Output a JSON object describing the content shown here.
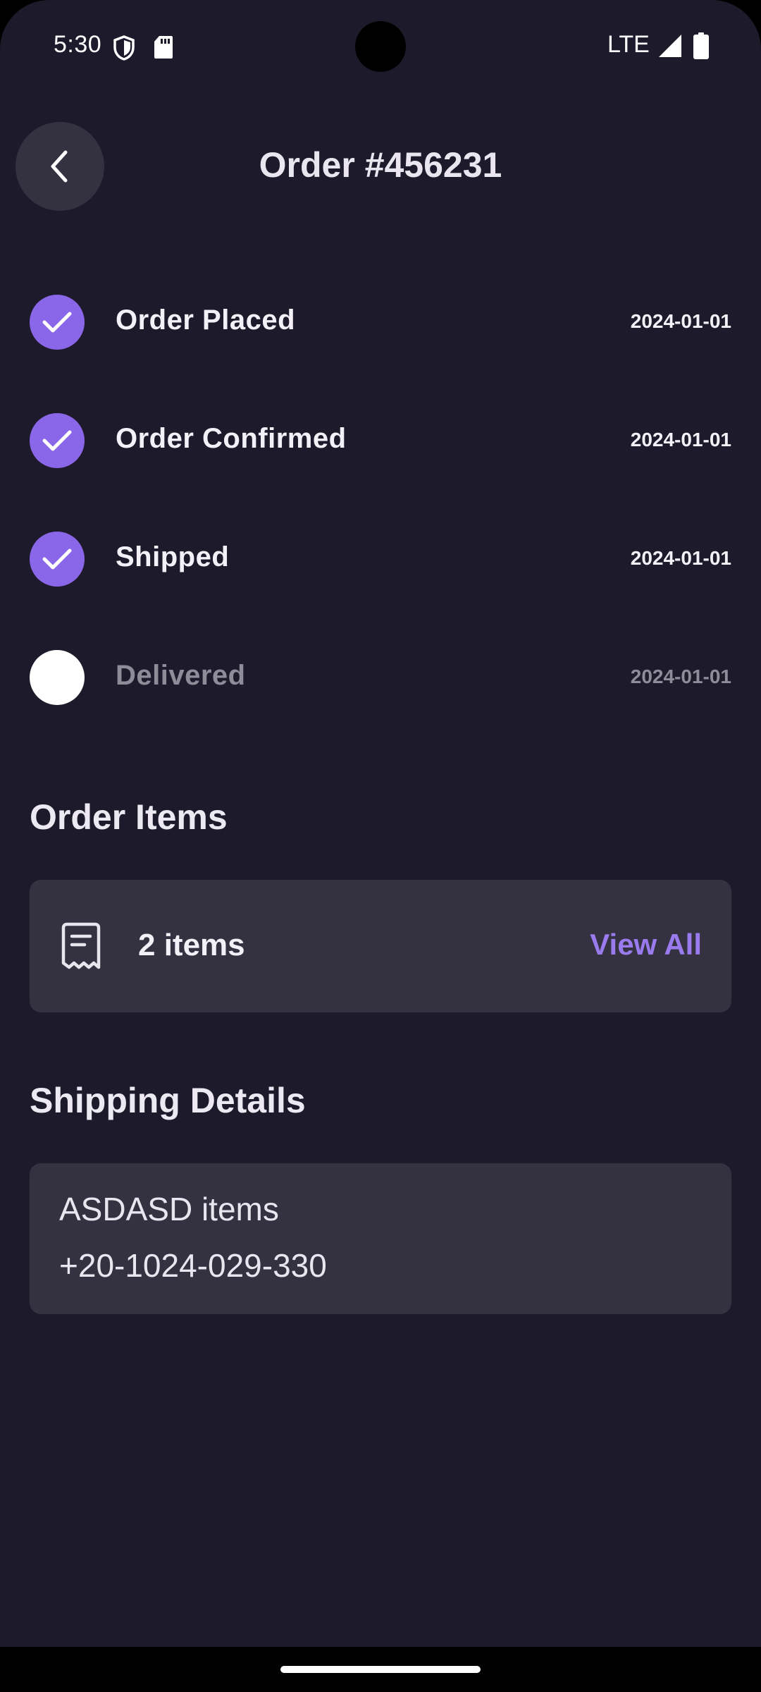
{
  "status_bar": {
    "time": "5:30",
    "network": "LTE",
    "icons": [
      "shield-icon",
      "sd-card-icon",
      "signal-icon",
      "battery-icon"
    ]
  },
  "header": {
    "title": "Order #456231",
    "back_icon": "chevron-left-icon"
  },
  "timeline": {
    "steps": [
      {
        "label": "Order Placed",
        "date": "2024-01-01",
        "completed": true
      },
      {
        "label": "Order Confirmed",
        "date": "2024-01-01",
        "completed": true
      },
      {
        "label": "Shipped",
        "date": "2024-01-01",
        "completed": true
      },
      {
        "label": "Delivered",
        "date": "2024-01-01",
        "completed": false
      }
    ]
  },
  "order_items": {
    "title": "Order Items",
    "count_label": "2 items",
    "view_all_label": "View All",
    "icon": "receipt-icon"
  },
  "shipping": {
    "title": "Shipping Details",
    "name": "ASDASD items",
    "phone": "+20-1024-029-330"
  },
  "colors": {
    "background": "#1d1a2b",
    "card": "#343140",
    "accent": "#8a66e8",
    "link": "#9a7bee",
    "text": "#f3f0f8",
    "muted_text": "#8f8c9a"
  }
}
